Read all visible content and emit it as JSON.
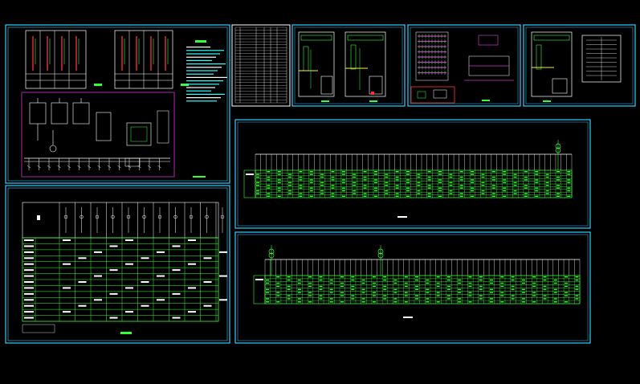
{
  "sheets": [
    {
      "id": "sheet-schematic-notes"
    },
    {
      "id": "sheet-equipment-table"
    },
    {
      "id": "sheet-material-list"
    },
    {
      "id": "sheet-floor-plans"
    },
    {
      "id": "sheet-sections"
    },
    {
      "id": "sheet-room-layout"
    },
    {
      "id": "sheet-long-system-1"
    },
    {
      "id": "sheet-long-system-2"
    }
  ],
  "colors": {
    "background": "#000000",
    "border": "#33ccff",
    "line_green": "#33ff33",
    "line_white": "#ffffff",
    "accent_magenta": "#cc33cc",
    "accent_red": "#ff3333",
    "accent_yellow": "#ffee33",
    "accent_cyan": "#33ffff"
  }
}
